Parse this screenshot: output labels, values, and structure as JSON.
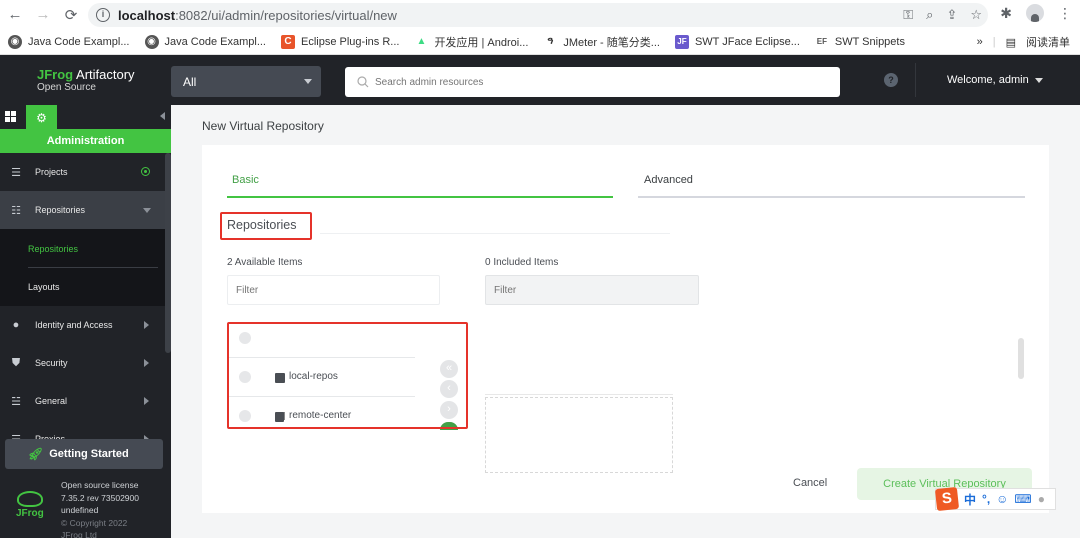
{
  "browser": {
    "url_host": "localhost",
    "url_rest": ":8082/ui/admin/repositories/virtual/new",
    "bookmarks": [
      {
        "label": "Java Code Exampl...",
        "icon": "globe-icon"
      },
      {
        "label": "Java Code Exampl...",
        "icon": "globe-icon"
      },
      {
        "label": "Eclipse Plug-ins R...",
        "icon": "c-icon"
      },
      {
        "label": "开发应用 | Androi...",
        "icon": "android-icon"
      },
      {
        "label": "JMeter - 随笔分类...",
        "icon": "feather-icon"
      },
      {
        "label": "SWT JFace Eclipse...",
        "icon": "jface-icon"
      },
      {
        "label": "SWT Snippets",
        "icon": "ef-icon"
      }
    ],
    "more_bookmarks": "»",
    "reading_list": "阅读清单"
  },
  "header": {
    "logo_brand": "JFrog",
    "logo_product": " Artifactory",
    "logo_edition": "Open Source",
    "scope_selected": "All",
    "search_placeholder": "Search admin resources",
    "help": "?",
    "welcome": "Welcome, admin"
  },
  "sidebar": {
    "section_label": "Administration",
    "items": [
      {
        "label": "Projects",
        "icon": "projects-icon"
      },
      {
        "label": "Repositories",
        "icon": "repositories-icon"
      },
      {
        "label": "Identity and Access",
        "icon": "user-icon"
      },
      {
        "label": "Security",
        "icon": "shield-icon"
      },
      {
        "label": "General",
        "icon": "sliders-icon"
      },
      {
        "label": "Proxies",
        "icon": "server-icon"
      }
    ],
    "sub_items": [
      {
        "label": "Repositories"
      },
      {
        "label": "Layouts"
      }
    ],
    "getting_started": "Getting Started",
    "footer": {
      "license": "Open source license",
      "version": "7.35.2 rev 73502900",
      "build": "undefined",
      "copyright": "© Copyright 2022",
      "company": "JFrog Ltd",
      "logo_text": "JFrog"
    }
  },
  "main": {
    "page_title": "New Virtual Repository",
    "tabs": [
      {
        "label": "Basic",
        "active": true
      },
      {
        "label": "Advanced",
        "active": false
      }
    ],
    "section_title": "Repositories",
    "available_label": "2 Available Items",
    "included_label": "0 Included Items",
    "filter_placeholder": "Filter",
    "available_items": [
      {
        "name": "",
        "type": "none"
      },
      {
        "name": "local-repos",
        "type": "local"
      },
      {
        "name": "remote-center",
        "type": "remote"
      }
    ],
    "move_buttons": [
      "«",
      "‹",
      "›",
      "»"
    ],
    "cancel": "Cancel",
    "create": "Create Virtual Repository"
  },
  "ime": {
    "logo": "S",
    "items": [
      "中",
      "°,",
      "☺",
      "⌨"
    ]
  },
  "colors": {
    "accent_green": "#43c442",
    "header_bg": "#212328",
    "highlight_red": "#e5332a"
  }
}
